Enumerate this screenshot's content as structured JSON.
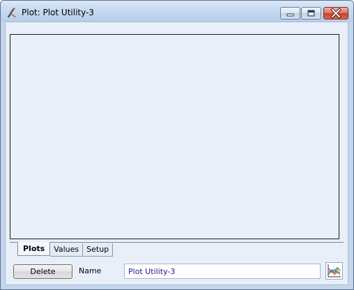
{
  "window": {
    "title": "Plot: Plot Utility-3"
  },
  "icons": {
    "app": "pencil-ruler-icon",
    "minimize": "minimize-icon",
    "maximize": "maximize-icon",
    "close": "close-icon",
    "plot_settings": "line-chart-icon"
  },
  "tabs": [
    {
      "label": "Plots",
      "active": true
    },
    {
      "label": "Values",
      "active": false
    },
    {
      "label": "Setup",
      "active": false
    }
  ],
  "footer": {
    "delete_label": "Delete",
    "name_label": "Name",
    "name_value": "Plot Utility-3"
  },
  "colors": {
    "plot_background": "#e9f0f9",
    "name_text": "#1a1a8c",
    "close_button": "#c4402a"
  }
}
